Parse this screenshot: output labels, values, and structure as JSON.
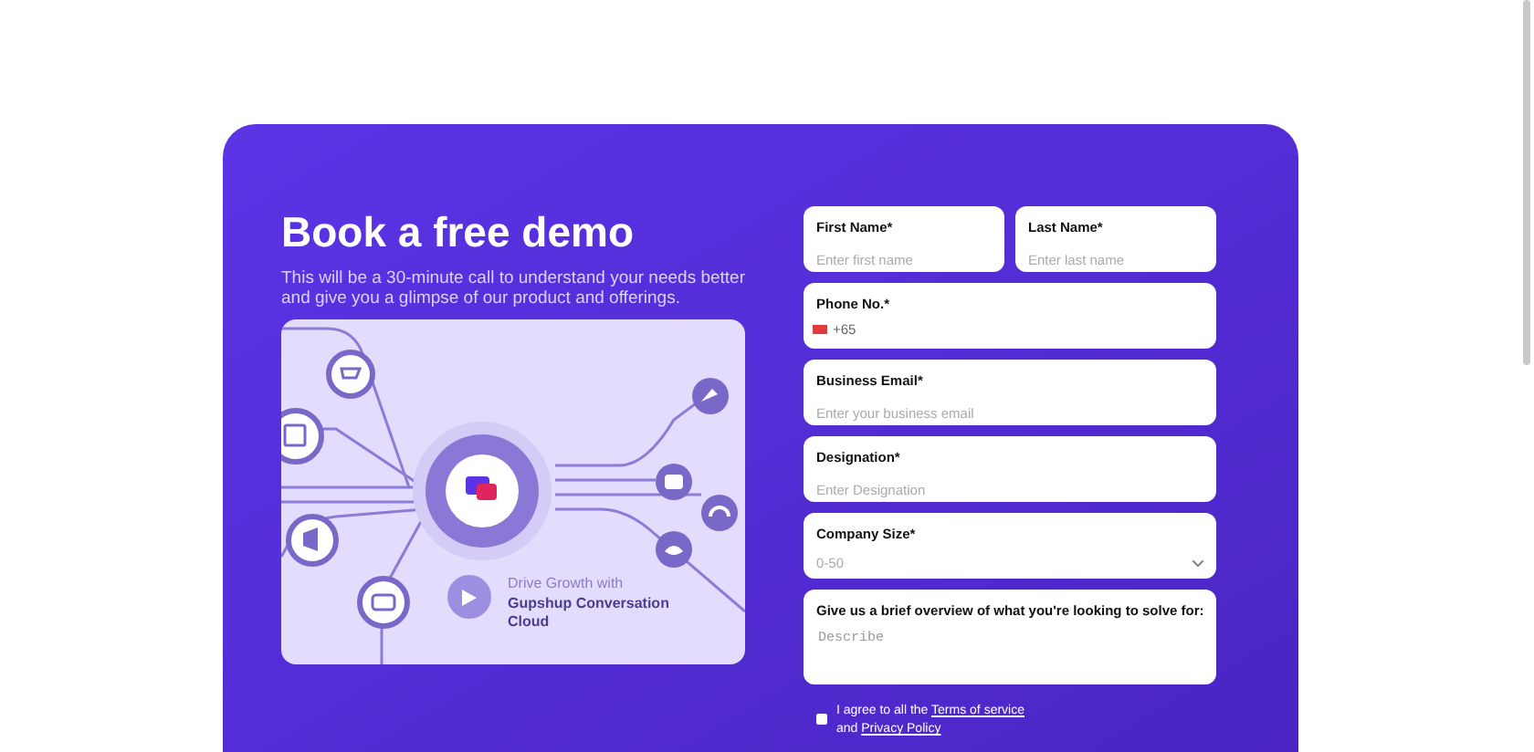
{
  "heading": "Book a free demo",
  "subheading": "This will be a 30-minute call to understand your needs better and give you a glimpse of our product and offerings.",
  "illustration": {
    "caption_small": "Drive Growth with",
    "caption_title": "Gupshup Conversation Cloud"
  },
  "form": {
    "rows": [
      [
        {
          "kind": "text",
          "label": "First Name*",
          "placeholder": "Enter first name"
        },
        {
          "kind": "text",
          "label": "Last Name*",
          "placeholder": "Enter last name"
        }
      ],
      [
        {
          "kind": "phone",
          "label": "Phone No.*",
          "value": "+65"
        }
      ],
      [
        {
          "kind": "text",
          "label": "Business Email*",
          "placeholder": "Enter your business email"
        }
      ],
      [
        {
          "kind": "text",
          "label": "Designation*",
          "placeholder": "Enter Designation"
        }
      ],
      [
        {
          "kind": "select",
          "label": "Company Size*",
          "value": "0-50"
        }
      ],
      [
        {
          "kind": "textarea",
          "label": "Give us a brief overview of what you're looking to solve for:",
          "placeholder": "Describe"
        }
      ]
    ],
    "agreement": {
      "checked": false,
      "text": "I agree to all the",
      "links": [
        "Terms of service",
        "Privacy Policy"
      ],
      "joiner": "and"
    }
  }
}
